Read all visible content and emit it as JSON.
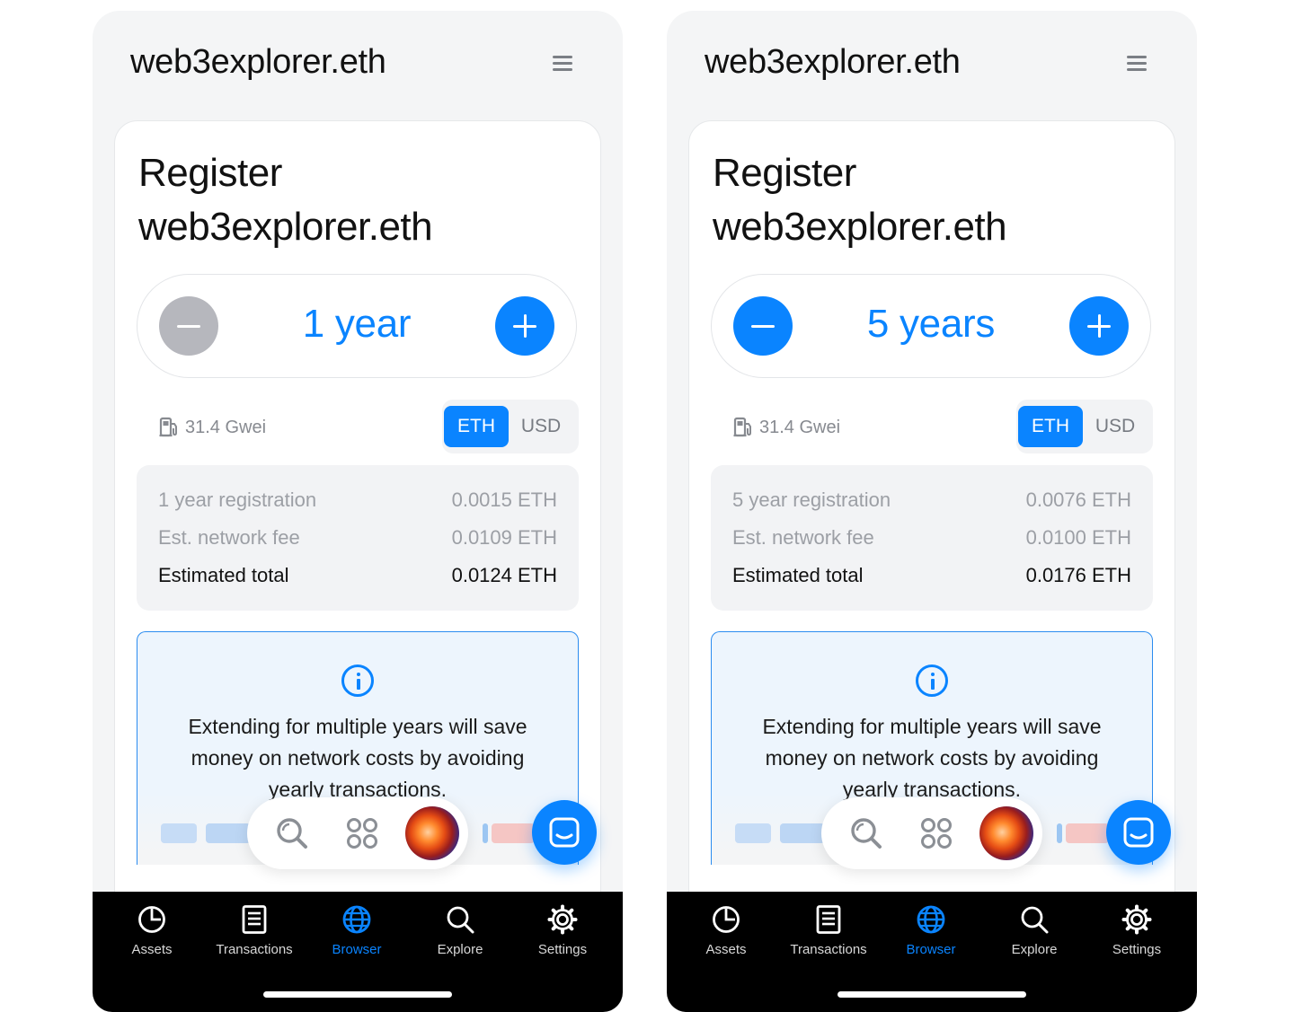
{
  "colors": {
    "accent": "#0a84ff",
    "disabled": "#b6b7bd",
    "tabbar": "#000000",
    "info_bg": "#edf5fd"
  },
  "screens": [
    {
      "site_title": "web3explorer.eth",
      "heading_line1": "Register",
      "heading_line2": "web3explorer.eth",
      "duration": "1 year",
      "minus_enabled": false,
      "gas": "31.4 Gwei",
      "currency_options": [
        "ETH",
        "USD"
      ],
      "selected_currency": "ETH",
      "fees": [
        {
          "label": "1 year registration",
          "value": "0.0015 ETH"
        },
        {
          "label": "Est. network fee",
          "value": "0.0109 ETH"
        },
        {
          "label": "Estimated total",
          "value": "0.0124 ETH"
        }
      ],
      "info_text": "Extending for multiple years will save money on network costs by avoiding yearly transactions."
    },
    {
      "site_title": "web3explorer.eth",
      "heading_line1": "Register",
      "heading_line2": "web3explorer.eth",
      "duration": "5 years",
      "minus_enabled": true,
      "gas": "31.4 Gwei",
      "currency_options": [
        "ETH",
        "USD"
      ],
      "selected_currency": "ETH",
      "fees": [
        {
          "label": "5 year registration",
          "value": "0.0076 ETH"
        },
        {
          "label": "Est. network fee",
          "value": "0.0100 ETH"
        },
        {
          "label": "Estimated total",
          "value": "0.0176 ETH"
        }
      ],
      "info_text": "Extending for multiple years will save money on network costs by avoiding yearly transactions."
    }
  ],
  "tabbar": {
    "active": "Browser",
    "items": [
      {
        "label": "Assets",
        "icon": "pie-chart-icon"
      },
      {
        "label": "Transactions",
        "icon": "document-icon"
      },
      {
        "label": "Browser",
        "icon": "globe-icon"
      },
      {
        "label": "Explore",
        "icon": "search-icon"
      },
      {
        "label": "Settings",
        "icon": "gear-icon"
      }
    ]
  }
}
